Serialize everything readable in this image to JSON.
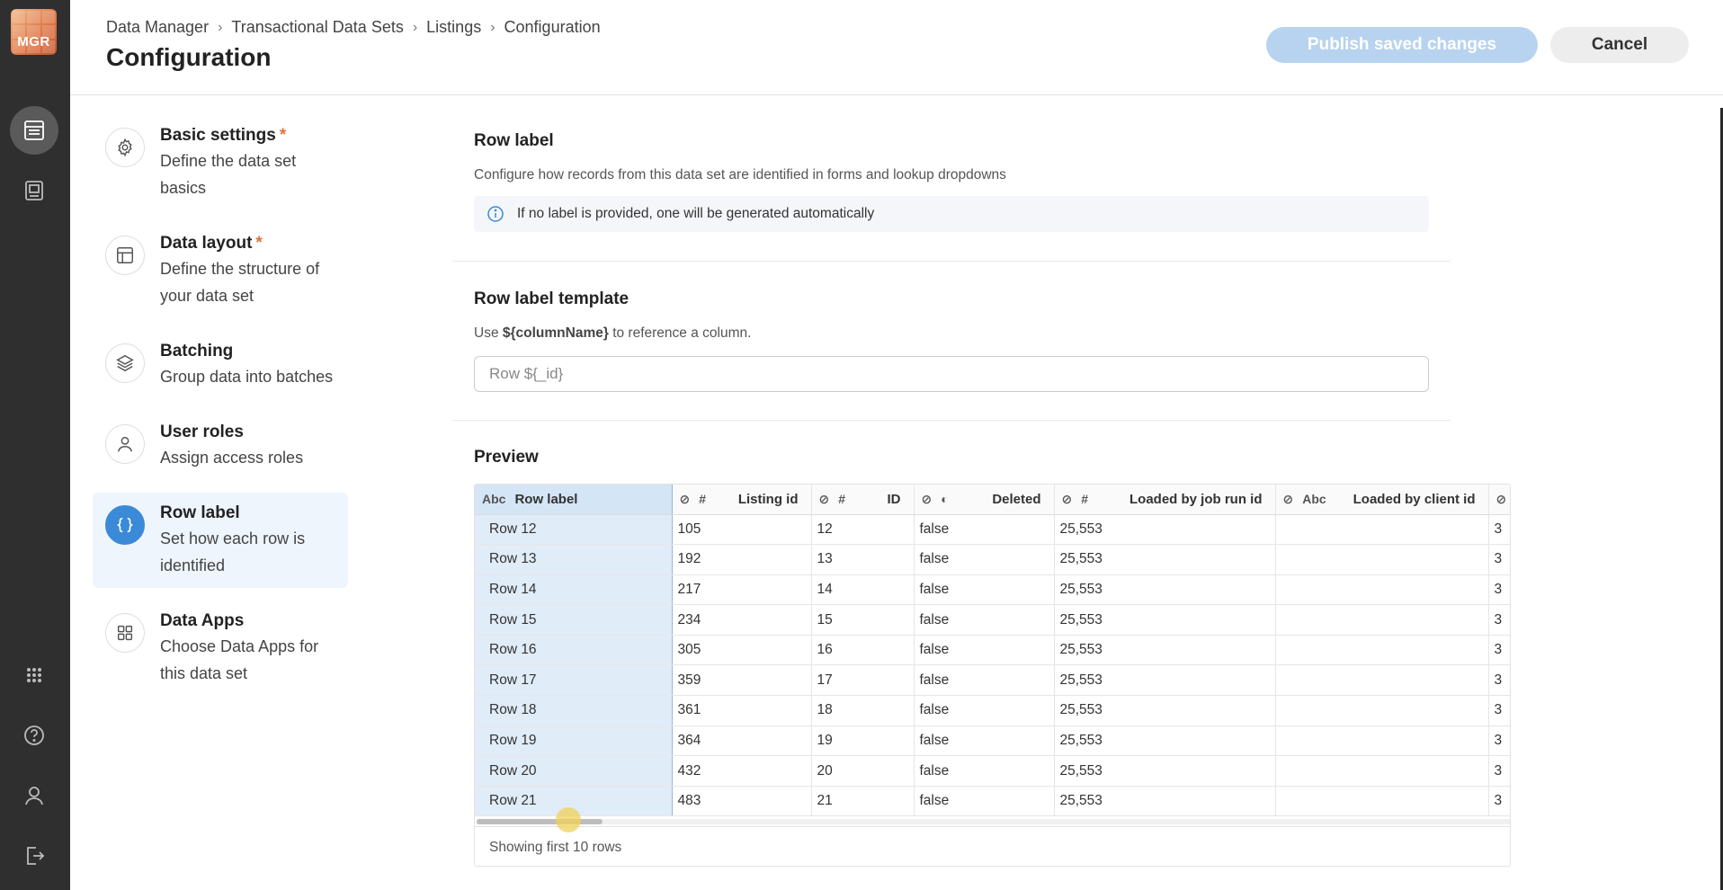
{
  "logo": {
    "text": "MGR"
  },
  "header": {
    "breadcrumb": [
      "Data Manager",
      "Transactional Data Sets",
      "Listings",
      "Configuration"
    ],
    "title": "Configuration",
    "publish_label": "Publish saved changes",
    "cancel_label": "Cancel"
  },
  "steps": [
    {
      "title": "Basic settings",
      "required": "*",
      "desc": "Define the data set basics",
      "icon": "gear-icon"
    },
    {
      "title": "Data layout",
      "required": "*",
      "desc": "Define the structure of your data set",
      "icon": "layout-icon"
    },
    {
      "title": "Batching",
      "required": "",
      "desc": "Group data into batches",
      "icon": "layers-icon"
    },
    {
      "title": "User roles",
      "required": "",
      "desc": "Assign access roles",
      "icon": "user-icon"
    },
    {
      "title": "Row label",
      "required": "",
      "desc": "Set how each row is identified",
      "icon": "braces-icon",
      "active": true
    },
    {
      "title": "Data Apps",
      "required": "",
      "desc": "Choose Data Apps for this data set",
      "icon": "apps-icon"
    }
  ],
  "row_label": {
    "title": "Row label",
    "desc": "Configure how records from this data set are identified in forms and lookup dropdowns",
    "info": "If no label is provided, one will be generated automatically"
  },
  "template": {
    "title": "Row label template",
    "desc_pre": "Use ",
    "desc_code": "${columnName}",
    "desc_post": " to reference a column.",
    "placeholder": "Row ${_id}"
  },
  "preview": {
    "title": "Preview",
    "columns": [
      {
        "type": "Abc",
        "name": "Row label"
      },
      {
        "type": "#",
        "name": "Listing id"
      },
      {
        "type": "#",
        "name": "ID"
      },
      {
        "type": "bool",
        "name": "Deleted"
      },
      {
        "type": "#",
        "name": "Loaded by job run id"
      },
      {
        "type": "Abc",
        "name": "Loaded by client id"
      }
    ],
    "rows": [
      [
        "Row 12",
        "105",
        "12",
        "false",
        "25,553",
        "",
        "3"
      ],
      [
        "Row 13",
        "192",
        "13",
        "false",
        "25,553",
        "",
        "3"
      ],
      [
        "Row 14",
        "217",
        "14",
        "false",
        "25,553",
        "",
        "3"
      ],
      [
        "Row 15",
        "234",
        "15",
        "false",
        "25,553",
        "",
        "3"
      ],
      [
        "Row 16",
        "305",
        "16",
        "false",
        "25,553",
        "",
        "3"
      ],
      [
        "Row 17",
        "359",
        "17",
        "false",
        "25,553",
        "",
        "3"
      ],
      [
        "Row 18",
        "361",
        "18",
        "false",
        "25,553",
        "",
        "3"
      ],
      [
        "Row 19",
        "364",
        "19",
        "false",
        "25,553",
        "",
        "3"
      ],
      [
        "Row 20",
        "432",
        "20",
        "false",
        "25,553",
        "",
        "3"
      ],
      [
        "Row 21",
        "483",
        "21",
        "false",
        "25,553",
        "",
        "3"
      ]
    ],
    "footer": "Showing first 10 rows"
  },
  "colors": {
    "accent": "#3a8ad8",
    "publish_disabled": "#b7d3ef",
    "rail": "#2f2f2f",
    "required": "#e0743a"
  }
}
